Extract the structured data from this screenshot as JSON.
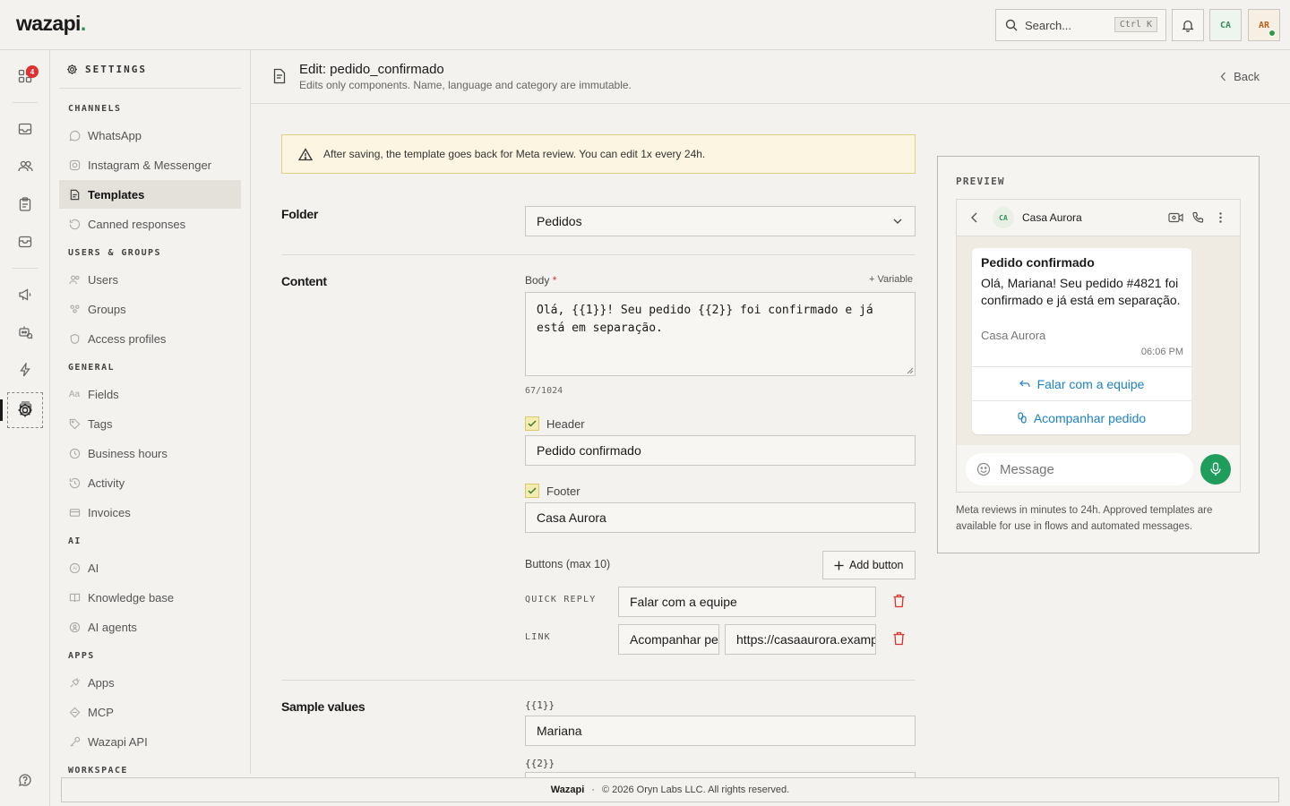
{
  "app": {
    "logo": "wazapi",
    "search_placeholder": "Search...",
    "search_shortcut": "Ctrl K",
    "workspace_initials": "CA",
    "user_initials": "AR"
  },
  "rail": {
    "inbox_badge": "4"
  },
  "settings": {
    "title": "SETTINGS",
    "sections": [
      {
        "title": "CHANNELS",
        "items": [
          "WhatsApp",
          "Instagram & Messenger",
          "Templates",
          "Canned responses"
        ]
      },
      {
        "title": "USERS & GROUPS",
        "items": [
          "Users",
          "Groups",
          "Access profiles"
        ]
      },
      {
        "title": "GENERAL",
        "items": [
          "Fields",
          "Tags",
          "Business hours",
          "Activity",
          "Invoices"
        ]
      },
      {
        "title": "AI",
        "items": [
          "AI",
          "Knowledge base",
          "AI agents"
        ]
      },
      {
        "title": "APPS",
        "items": [
          "Apps",
          "MCP",
          "Wazapi API"
        ]
      },
      {
        "title": "WORKSPACE",
        "items": []
      }
    ],
    "active_item": "Templates"
  },
  "header": {
    "title": "Edit: pedido_confirmado",
    "subtitle": "Edits only components. Name, language and category are immutable.",
    "back_label": "Back"
  },
  "alert": {
    "text": "After saving, the template goes back for Meta review. You can edit 1x every 24h."
  },
  "form": {
    "folder_label": "Folder",
    "folder_value": "Pedidos",
    "content_label": "Content",
    "body_label": "Body",
    "body_required": "*",
    "add_variable": "+ Variable",
    "body_value": "Olá, {{1}}! Seu pedido {{2}} foi confirmado e já está em separação.",
    "char_count": "67/1024",
    "header_label": "Header",
    "header_value": "Pedido confirmado",
    "footer_label": "Footer",
    "footer_value": "Casa Aurora",
    "buttons_label": "Buttons (max 10)",
    "add_button": "Add button",
    "buttons": [
      {
        "type": "QUICK REPLY",
        "text": "Falar com a equipe"
      },
      {
        "type": "LINK",
        "text": "Acompanhar pedido",
        "url": "https://casaaurora.example"
      }
    ],
    "sample_label": "Sample values",
    "samples": [
      {
        "var": "{{1}}",
        "value": "Mariana"
      },
      {
        "var": "{{2}}",
        "value": ""
      }
    ]
  },
  "preview": {
    "title": "PREVIEW",
    "contact_initials": "CA",
    "contact_name": "Casa Aurora",
    "msg_header": "Pedido confirmado",
    "msg_body": "Olá, Mariana! Seu pedido #4821 foi confirmado e já está em separação.",
    "msg_footer": "Casa Aurora",
    "msg_time": "06:06 PM",
    "btn1": "Falar com a equipe",
    "btn2": "Acompanhar pedido",
    "input_placeholder": "Message",
    "note": "Meta reviews in minutes to 24h. Approved templates are available for use in flows and automated messages."
  },
  "footer": {
    "brand": "Wazapi",
    "sep": "·",
    "copyright": "© 2026 Oryn Labs LLC. All rights reserved."
  },
  "colors": {
    "accent_green": "#1f9d5c",
    "danger": "#d9342c",
    "alert_bg": "#fbf5e2",
    "link_blue": "#1e82c8"
  }
}
